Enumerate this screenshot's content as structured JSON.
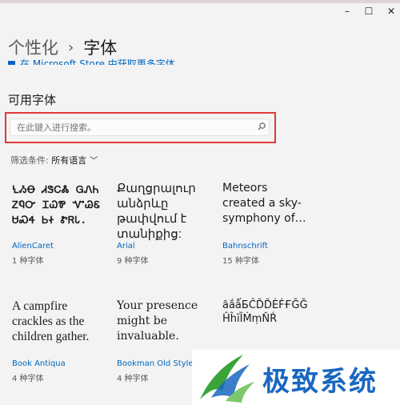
{
  "window": {
    "minimize_glyph": "–",
    "maximize_glyph": "☐",
    "close_glyph": "✕"
  },
  "breadcrumb": {
    "parent": "个性化",
    "separator": "›",
    "current": "字体"
  },
  "store_link": "在 Microsoft Store 中获取更多字体",
  "available_fonts": {
    "title": "可用字体",
    "search_placeholder": "在此键入进行搜索。",
    "filter_label": "筛选条件:",
    "filter_value": "所有语言",
    "filter_chevron": "﹀"
  },
  "fonts": [
    {
      "sample": [
        "ꝆᏱꝊ ᏗᏕᏟᏜ ᏀᏁᏂ",
        "ᏃᏄᏅ ᏆᏇᏈ ᏉᏊᏋ",
        "ᏌᏍᏎ ᏏᏐ ᏑᏒᏓ."
      ],
      "name": "AlienCaret",
      "count": "1 种字体"
    },
    {
      "sample": [
        "Քաղցրալուր",
        "անձրևը",
        "թափվում է",
        "տանիքից:"
      ],
      "name": "Arial",
      "count": "9 种字体"
    },
    {
      "sample": [
        "Meteors",
        "created a sky-",
        "symphony of…"
      ],
      "name": "Bahnschrift",
      "count": "15 种字体"
    },
    {
      "sample": [
        "A campfire",
        "crackles as the",
        "children gather."
      ],
      "name": "Book Antiqua",
      "count": "4 种字体"
    },
    {
      "sample": [
        "Your presence",
        "might be",
        "invaluable."
      ],
      "name": "Bookman Old Style",
      "count": "4 种字体"
    },
    {
      "sample": [
        "ăắǻБĈĎĎĖḞҒĞĞ",
        "ĤĥĭȈṀṃŇŔ"
      ],
      "name": "",
      "count": ""
    }
  ],
  "watermark": {
    "text": "极致系统"
  },
  "colors": {
    "accent": "#0067c0",
    "highlight_box": "#e03a3a",
    "watermark_blue": "#1967c0",
    "watermark_green": "#3aa33a"
  }
}
